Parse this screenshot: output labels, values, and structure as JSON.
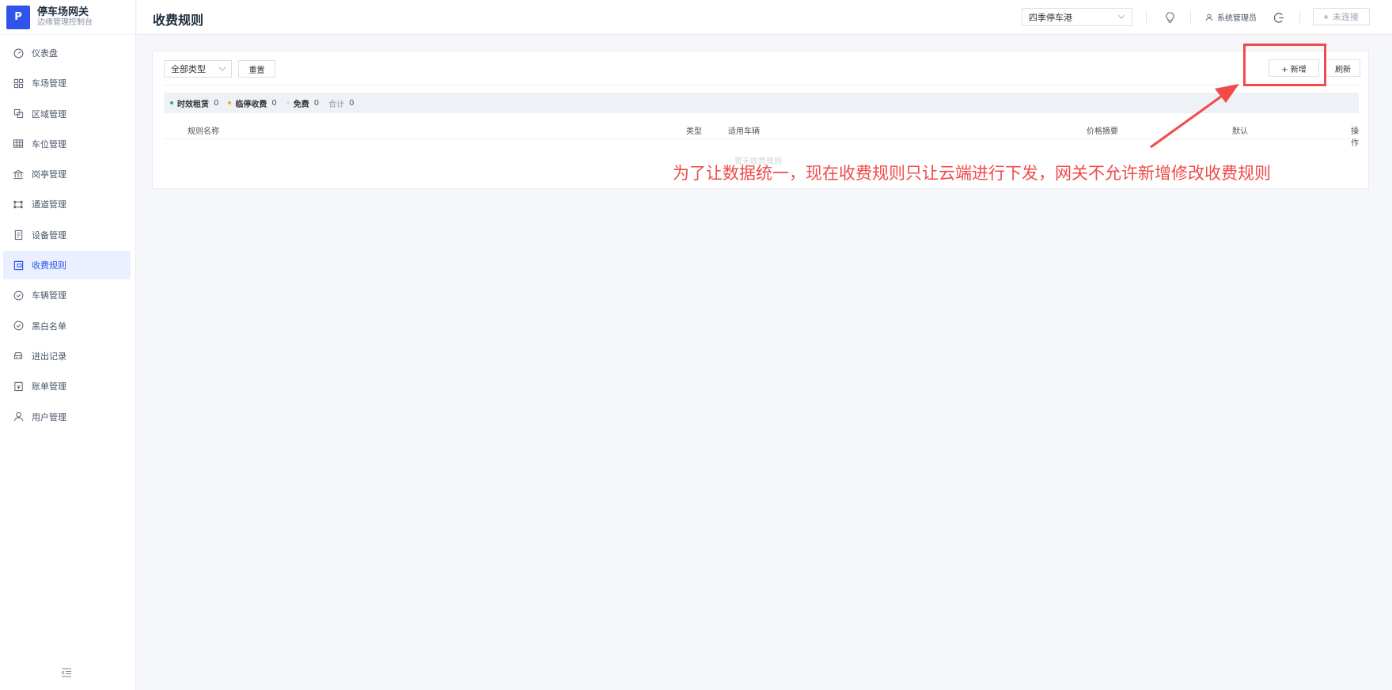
{
  "brand": {
    "logo": "P",
    "title": "停车场网关",
    "subtitle": "边缘管理控制台"
  },
  "sidebar": {
    "items": [
      {
        "label": "仪表盘",
        "icon": "dashboard-icon",
        "active": false
      },
      {
        "label": "车场管理",
        "icon": "grid-icon",
        "active": false
      },
      {
        "label": "区域管理",
        "icon": "area-icon",
        "active": false
      },
      {
        "label": "车位管理",
        "icon": "table-icon",
        "active": false
      },
      {
        "label": "岗亭管理",
        "icon": "bank-icon",
        "active": false
      },
      {
        "label": "通道管理",
        "icon": "gate-icon",
        "active": false
      },
      {
        "label": "设备管理",
        "icon": "device-icon",
        "active": false
      },
      {
        "label": "收费规则",
        "icon": "wallet-icon",
        "active": true
      },
      {
        "label": "车辆管理",
        "icon": "shield-check-icon",
        "active": false
      },
      {
        "label": "黑白名单",
        "icon": "shield-check-icon",
        "active": false
      },
      {
        "label": "进出记录",
        "icon": "car-icon",
        "active": false
      },
      {
        "label": "账单管理",
        "icon": "bill-icon",
        "active": false
      },
      {
        "label": "用户管理",
        "icon": "user-icon",
        "active": false
      }
    ]
  },
  "header": {
    "title": "收费规则",
    "lot_select": "四季停车港",
    "user_name": "系统管理员",
    "connection_status": "未连接"
  },
  "toolbar": {
    "type_select": "全部类型",
    "reset_label": "重置",
    "add_label": "+ 新增",
    "refresh_label": "刷新"
  },
  "stats": {
    "items": [
      {
        "label": "时效租赁",
        "count": "0",
        "color": "#22b573"
      },
      {
        "label": "临停收费",
        "count": "0",
        "color": "#f5a623"
      },
      {
        "label": "免费",
        "count": "0",
        "color": "#d9dde3"
      }
    ],
    "total_label": "合计",
    "total_count": "0"
  },
  "table": {
    "columns": [
      "规则名称",
      "类型",
      "适用车辆",
      "价格摘要",
      "默认",
      "操作"
    ],
    "empty_text": "暂无收费规则"
  },
  "annotation": {
    "text": "为了让数据统一，现在收费规则只让云端进行下发，网关不允许新增修改收费规则",
    "color": "#f04a4a"
  }
}
